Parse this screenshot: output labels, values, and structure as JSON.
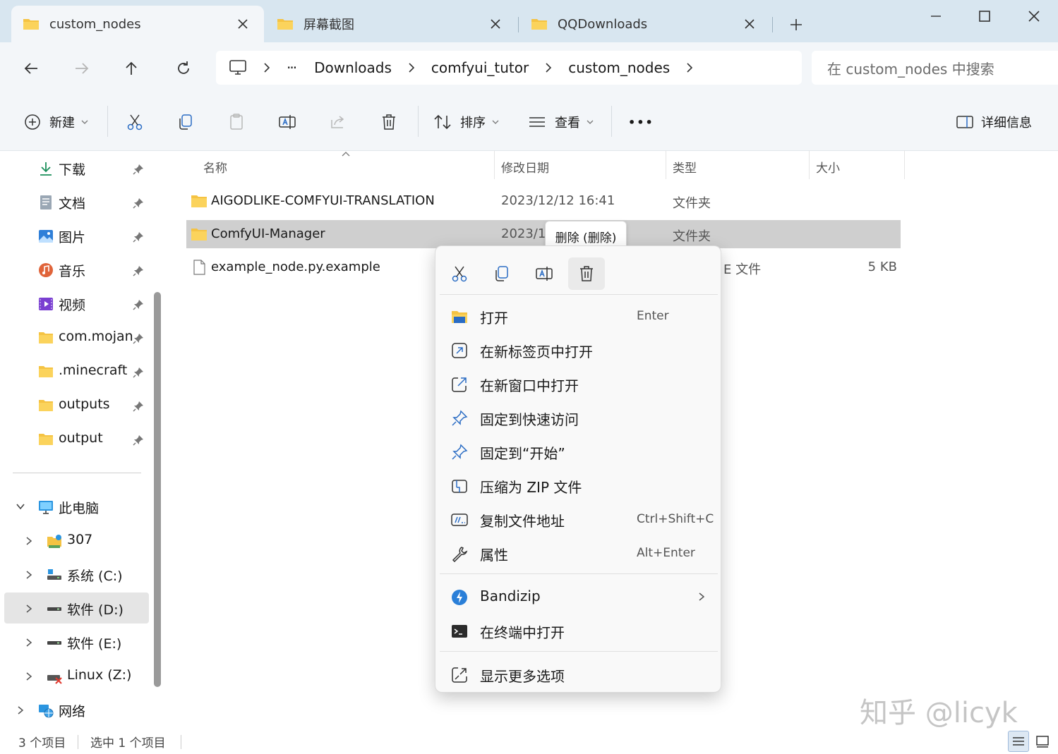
{
  "tabs": [
    {
      "label": "custom_nodes",
      "active": true
    },
    {
      "label": "屏幕截图",
      "active": false
    },
    {
      "label": "QQDownloads",
      "active": false
    }
  ],
  "address": {
    "ellipsis": "···",
    "crumbs": [
      "Downloads",
      "comfyui_tutor",
      "custom_nodes"
    ],
    "search_placeholder": "在 custom_nodes 中搜索"
  },
  "toolbar": {
    "new_label": "新建",
    "sort_label": "排序",
    "view_label": "查看",
    "more_label": "•••",
    "details_label": "详细信息"
  },
  "nav": {
    "quick": [
      {
        "label": "下载",
        "icon": "download-icon"
      },
      {
        "label": "文档",
        "icon": "document-icon"
      },
      {
        "label": "图片",
        "icon": "pictures-icon"
      },
      {
        "label": "音乐",
        "icon": "music-icon"
      },
      {
        "label": "视频",
        "icon": "video-icon"
      },
      {
        "label": "com.mojang",
        "icon": "folder-icon"
      },
      {
        "label": ".minecraft",
        "icon": "folder-icon"
      },
      {
        "label": "outputs",
        "icon": "folder-icon"
      },
      {
        "label": "output",
        "icon": "folder-icon"
      }
    ],
    "this_pc": "此电脑",
    "drives": [
      {
        "label": "307"
      },
      {
        "label": "系统 (C:)"
      },
      {
        "label": "软件 (D:)",
        "selected": true
      },
      {
        "label": "软件 (E:)"
      },
      {
        "label": "Linux (Z:)"
      }
    ],
    "network": "网络"
  },
  "columns": {
    "name": "名称",
    "date": "修改日期",
    "type": "类型",
    "size": "大小"
  },
  "files": [
    {
      "name": "AIGODLIKE-COMFYUI-TRANSLATION",
      "date": "2023/12/12 16:41",
      "type": "文件夹",
      "size": ""
    },
    {
      "name": "ComfyUI-Manager",
      "date": "2023/1",
      "type": "文件夹",
      "size": ""
    },
    {
      "name": "example_node.py.example",
      "date": "",
      "type": "E 文件",
      "size": "5 KB"
    }
  ],
  "context_menu": {
    "tooltip": "删除 (删除)",
    "items": [
      {
        "label": "打开",
        "shortcut": "Enter"
      },
      {
        "label": "在新标签页中打开",
        "shortcut": ""
      },
      {
        "label": "在新窗口中打开",
        "shortcut": ""
      },
      {
        "label": "固定到快速访问",
        "shortcut": ""
      },
      {
        "label": "固定到“开始”",
        "shortcut": ""
      },
      {
        "label": "压缩为 ZIP 文件",
        "shortcut": ""
      },
      {
        "label": "复制文件地址",
        "shortcut": "Ctrl+Shift+C"
      },
      {
        "label": "属性",
        "shortcut": "Alt+Enter"
      }
    ],
    "bandizip": "Bandizip",
    "terminal": "在终端中打开",
    "more": "显示更多选项"
  },
  "status": {
    "count": "3 个项目",
    "selected": "选中 1 个项目"
  },
  "watermark": "知乎 @licyk",
  "colors": {
    "selection": "#cfcfcf",
    "accent": "#0067c0",
    "folder": "#f5c343"
  }
}
